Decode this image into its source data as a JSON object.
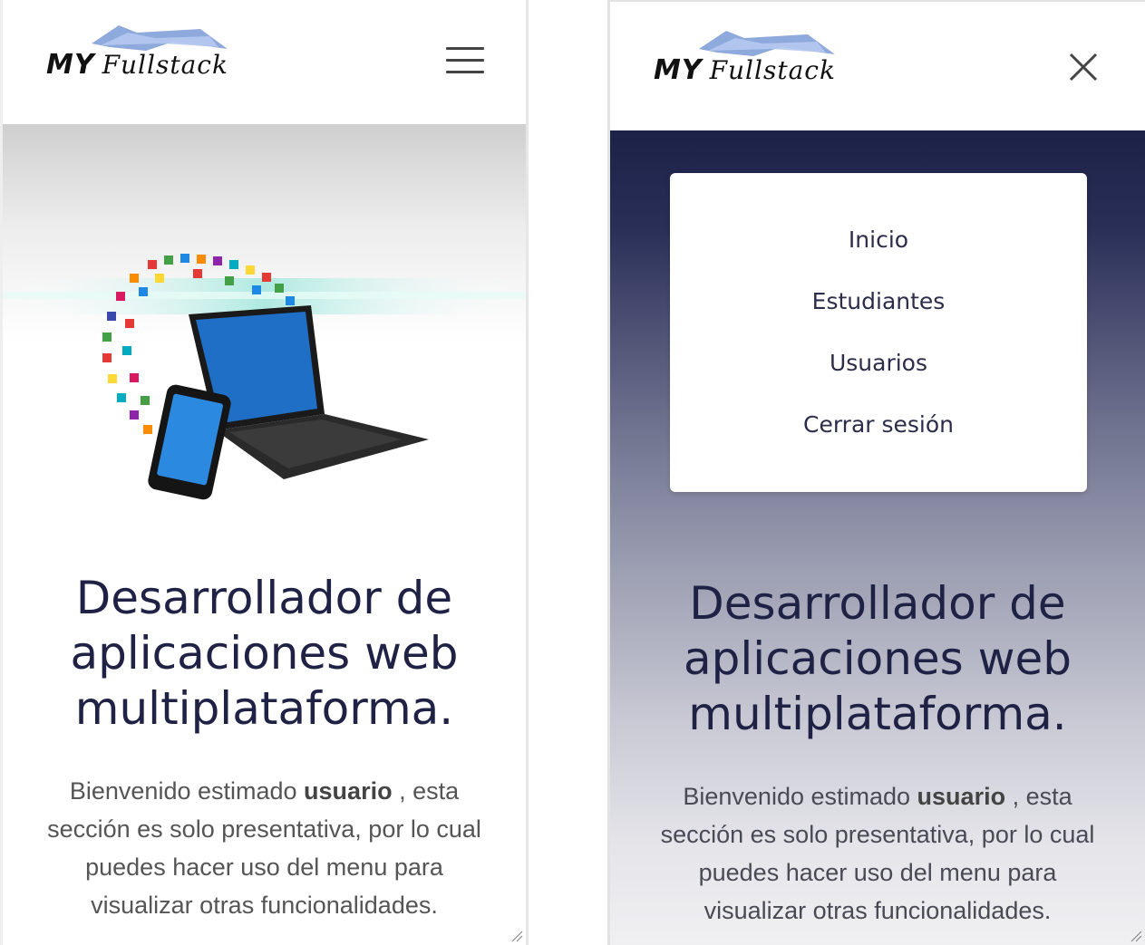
{
  "brand": {
    "logo_text_a": "MY",
    "logo_text_b": "Fullstack"
  },
  "left_panel": {
    "headline": [
      "Desarrollador de",
      "aplicaciones web",
      "multiplataforma."
    ],
    "body_prefix": "Bienvenido estimado ",
    "body_bold": "usuario",
    "body_suffix": " , esta sección es solo presentativa, por lo cual puedes hacer uso del menu para visualizar otras funcionalidades."
  },
  "right_panel": {
    "menu_items": [
      "Inicio",
      "Estudiantes",
      "Usuarios",
      "Cerrar sesión"
    ],
    "headline": [
      "Desarrollador de",
      "aplicaciones web",
      "multiplataforma."
    ],
    "body_prefix": "Bienvenido estimado ",
    "body_bold": "usuario",
    "body_suffix": " , esta sección es solo presentativa, por lo cual puedes hacer uso del menu para visualizar otras funcionalidades."
  },
  "icons": {
    "menu": "hamburger-menu-icon",
    "close": "close-icon",
    "resize": "resize-grip-icon"
  },
  "colors": {
    "headline": "#1f2145",
    "overlay_top": "#1c2147",
    "body_text": "#555555"
  }
}
